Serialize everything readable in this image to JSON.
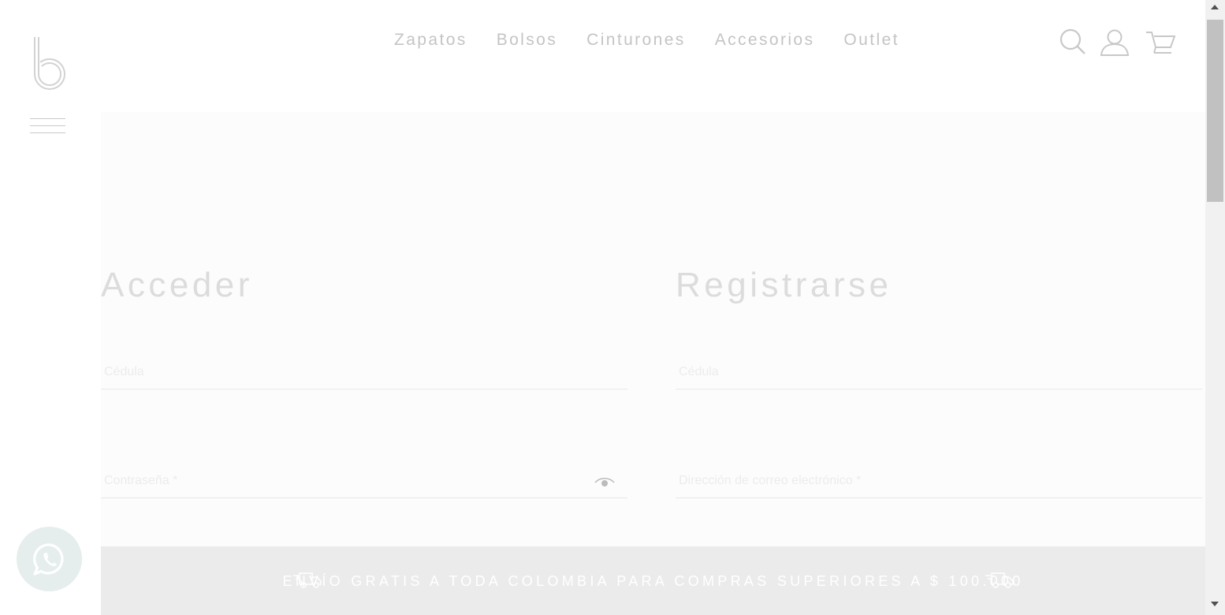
{
  "header": {
    "logo_icon": "b-logo-icon",
    "menu_icon": "hamburger-menu-icon",
    "nav": [
      {
        "label": "Zapatos"
      },
      {
        "label": "Bolsos"
      },
      {
        "label": "Cinturones"
      },
      {
        "label": "Accesorios"
      },
      {
        "label": "Outlet"
      }
    ],
    "icons": [
      "search-icon",
      "user-icon",
      "cart-icon"
    ]
  },
  "login": {
    "title": "Acceder",
    "cedula_label": "Cédula",
    "password_label": "Contraseña *",
    "show_password_icon": "eye-icon"
  },
  "register": {
    "title": "Registrarse",
    "cedula_label": "Cédula",
    "email_label": "Dirección de correo electrónico *"
  },
  "banner": {
    "text": "ENVÍO GRATIS A TODA COLOMBIA PARA COMPRAS SUPERIORES A $ 100.000",
    "icon": "delivery-truck-icon"
  },
  "whatsapp": {
    "icon": "whatsapp-icon"
  },
  "colors": {
    "nav_text": "#c4c4c4",
    "panel_bg": "#fcfcfc",
    "banner_bg": "#ebebeb",
    "whatsapp_bg": "#e5eeec"
  }
}
